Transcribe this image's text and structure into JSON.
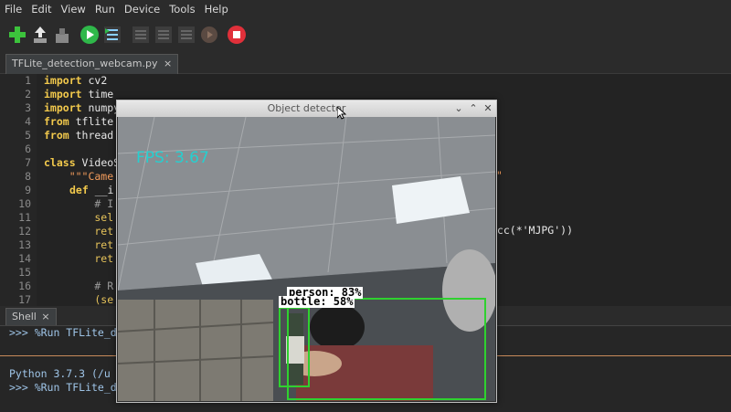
{
  "menu": [
    "File",
    "Edit",
    "View",
    "Run",
    "Device",
    "Tools",
    "Help"
  ],
  "toolbar": {
    "icons": [
      "new-file-icon",
      "load-icon",
      "save-icon",
      "run-icon",
      "debug-icon",
      "step-over-icon",
      "step-into-icon",
      "step-out-icon",
      "resume-icon",
      "stop-icon"
    ]
  },
  "editor_tab": {
    "label": "TFLite_detection_webcam.py",
    "close": "×"
  },
  "code": {
    "line_numbers": [
      "1",
      "2",
      "3",
      "4",
      "5",
      "6",
      "7",
      "8",
      "9",
      "10",
      "11",
      "12",
      "13",
      "14",
      "15",
      "16",
      "17"
    ],
    "lines": [
      {
        "kw": "import",
        "rest": " cv2"
      },
      {
        "kw": "import",
        "rest": " time"
      },
      {
        "kw": "import",
        "rest": " numpy"
      },
      {
        "kw": "from",
        "rest": " tflite"
      },
      {
        "kw": "from",
        "rest": " thread"
      },
      {
        "kw": "",
        "rest": ""
      },
      {
        "kw": "class",
        "rest": " VideoS"
      },
      {
        "kw": "",
        "rest": "    \"\"\"Came"
      },
      {
        "kw": "def",
        "rest": " __i"
      },
      {
        "kw": "",
        "rest": "        # I"
      },
      {
        "kw": "",
        "rest": "        sel"
      },
      {
        "kw": "",
        "rest": "        ret"
      },
      {
        "kw": "",
        "rest": "        ret"
      },
      {
        "kw": "",
        "rest": "        ret"
      },
      {
        "kw": "",
        "rest": ""
      },
      {
        "kw": "",
        "rest": "        # R"
      },
      {
        "kw": "",
        "rest": "        (se"
      }
    ],
    "right_fragment_1": "\"",
    "right_fragment_2": "rcc(*'MJPG'))"
  },
  "shell": {
    "tab_label": "Shell",
    "close": "×",
    "line1": ">>> %Run TFLite_d",
    "line2": "Python 3.7.3 (/u",
    "line3": ">>> %Run TFLite_d"
  },
  "detector_window": {
    "title": "Object detector",
    "fps_text": "FPS: 3.67",
    "detections": [
      {
        "label": "person: 83%",
        "color": "#2fd12f"
      },
      {
        "label": "bottle: 58%",
        "color": "#2fd12f"
      }
    ]
  },
  "colors": {
    "accent_green": "#2fd12f",
    "fps_cyan": "#25d0d0"
  }
}
